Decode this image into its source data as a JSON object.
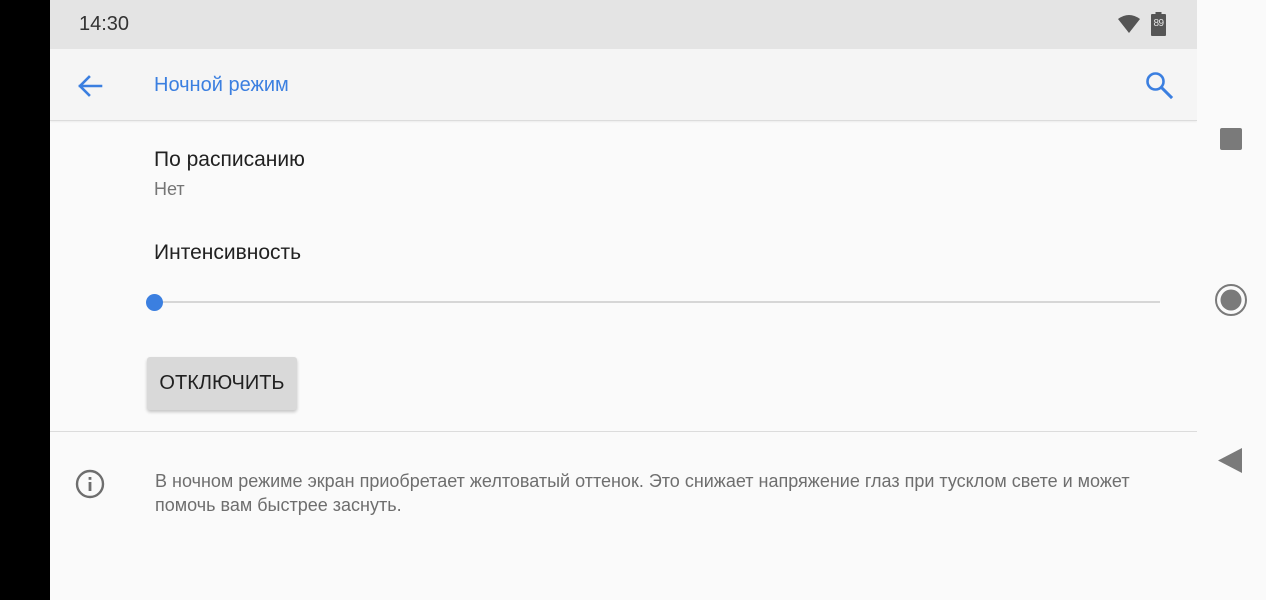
{
  "status_bar": {
    "time": "14:30",
    "battery_level": "89",
    "icons": [
      "wifi-icon",
      "battery-icon"
    ]
  },
  "app_bar": {
    "title": "Ночной режим",
    "icons": [
      "arrow-back-icon",
      "search-icon"
    ]
  },
  "settings": {
    "schedule": {
      "title": "По расписанию",
      "value": "Нет"
    },
    "intensity": {
      "title": "Интенсивность",
      "level_percent": 0
    },
    "off_button": "ОТКЛЮЧИТЬ"
  },
  "info": {
    "icon": "info-icon",
    "text": "В ночном режиме экран приобретает желтоватый оттенок. Это снижает напряжение глаз при тусклом свете и может помочь вам быстрее заснуть."
  },
  "nav_bar": {
    "buttons": [
      "recents-icon",
      "home-icon",
      "back-triangle-icon"
    ]
  },
  "colors": {
    "accent": "#3b7fe0",
    "status_bar": "#e4e4e4",
    "background": "#fafafa",
    "button": "#d9d9d9"
  }
}
